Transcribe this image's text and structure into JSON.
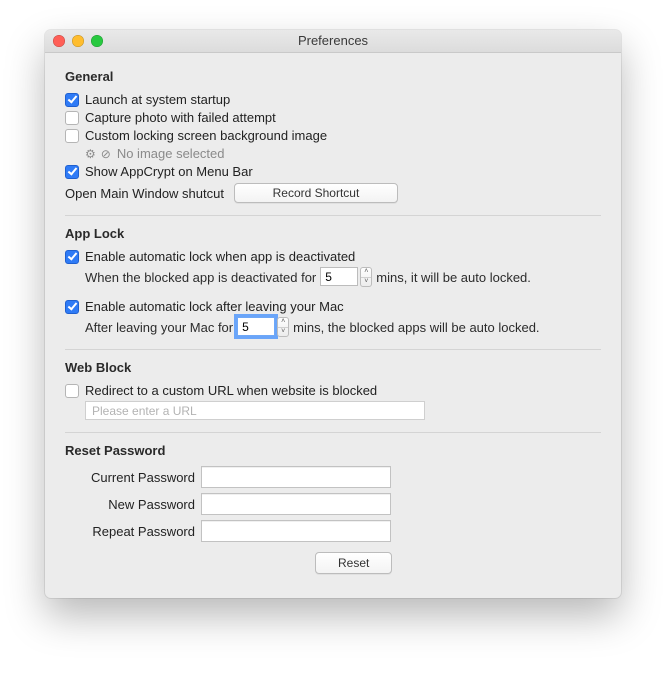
{
  "window": {
    "title": "Preferences"
  },
  "general": {
    "header": "General",
    "launch_at_startup": "Launch at system startup",
    "capture_photo": "Capture photo with failed attempt",
    "custom_bg": "Custom locking screen background image",
    "no_image_selected": "No image selected",
    "show_menubar": "Show AppCrypt on Menu Bar",
    "open_main_shortcut_label": "Open Main Window shutcut",
    "record_shortcut_button": "Record Shortcut"
  },
  "applock": {
    "header": "App Lock",
    "enable_deactivated": "Enable automatic lock when app is deactivated",
    "deactivated_hint_pre": "When the blocked app is deactivated for",
    "deactivated_mins": "5",
    "deactivated_hint_post": "mins, it will be auto locked.",
    "enable_leaving": "Enable automatic lock after leaving your Mac",
    "leaving_hint_pre": "After leaving your Mac for",
    "leaving_mins": "5",
    "leaving_hint_post": "mins, the blocked apps will be auto locked."
  },
  "webblock": {
    "header": "Web Block",
    "redirect_label": "Redirect to a custom URL when website is blocked",
    "url_placeholder": "Please enter a URL"
  },
  "resetpw": {
    "header": "Reset Password",
    "current_label": "Current Password",
    "new_label": "New Password",
    "repeat_label": "Repeat Password",
    "reset_button": "Reset"
  }
}
